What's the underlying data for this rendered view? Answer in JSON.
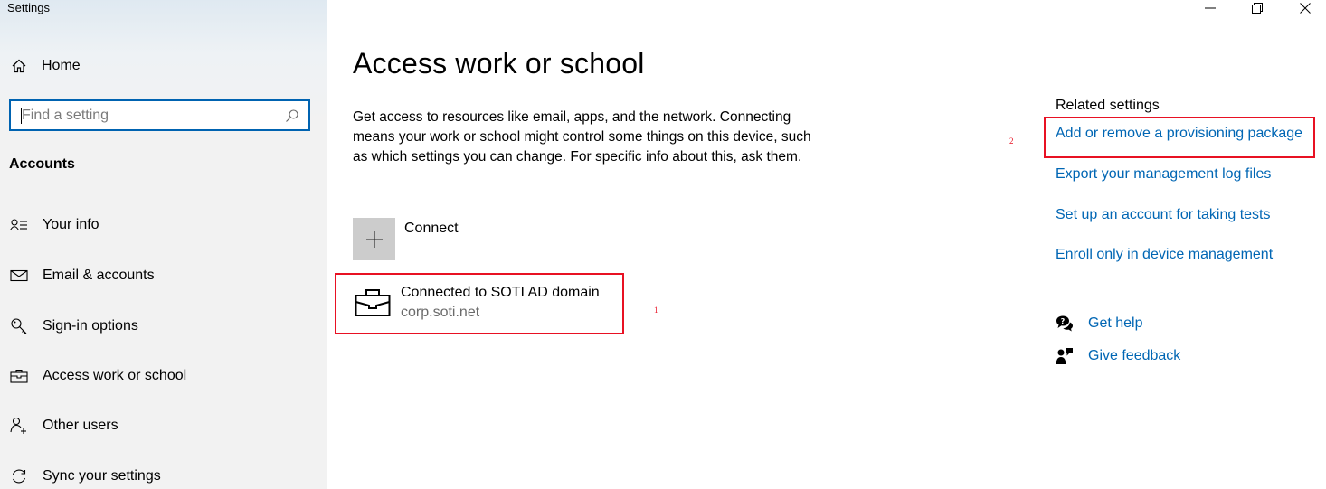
{
  "window": {
    "title": "Settings",
    "controls": {
      "minimize": "minimize",
      "maximize": "restore",
      "close": "close"
    }
  },
  "sidebar": {
    "home_label": "Home",
    "search_placeholder": "Find a setting",
    "search_value": "",
    "section_title": "Accounts",
    "items": [
      {
        "label": "Your info",
        "icon": "person-list-icon"
      },
      {
        "label": "Email & accounts",
        "icon": "mail-icon"
      },
      {
        "label": "Sign-in options",
        "icon": "key-icon"
      },
      {
        "label": "Access work or school",
        "icon": "briefcase-icon"
      },
      {
        "label": "Other users",
        "icon": "person-add-icon"
      },
      {
        "label": "Sync your settings",
        "icon": "sync-icon"
      }
    ]
  },
  "main": {
    "title": "Access work or school",
    "description": "Get access to resources like email, apps, and the network. Connecting means your work or school might control some things on this device, such as which settings you can change. For specific info about this, ask them.",
    "connect_label": "Connect",
    "account": {
      "title": "Connected to SOTI AD domain",
      "subtitle": "corp.soti.net"
    },
    "marker_1": "1",
    "marker_2": "2"
  },
  "related": {
    "title": "Related settings",
    "links": [
      "Add or remove a provisioning package",
      "Export your management log files",
      "Set up an account for taking tests",
      "Enroll only in device management"
    ],
    "help": "Get help",
    "feedback": "Give feedback"
  },
  "colors": {
    "accent": "#0063b1",
    "link": "#0066b4",
    "highlight": "#e81123",
    "sidebar_bg": "#f2f2f2"
  }
}
